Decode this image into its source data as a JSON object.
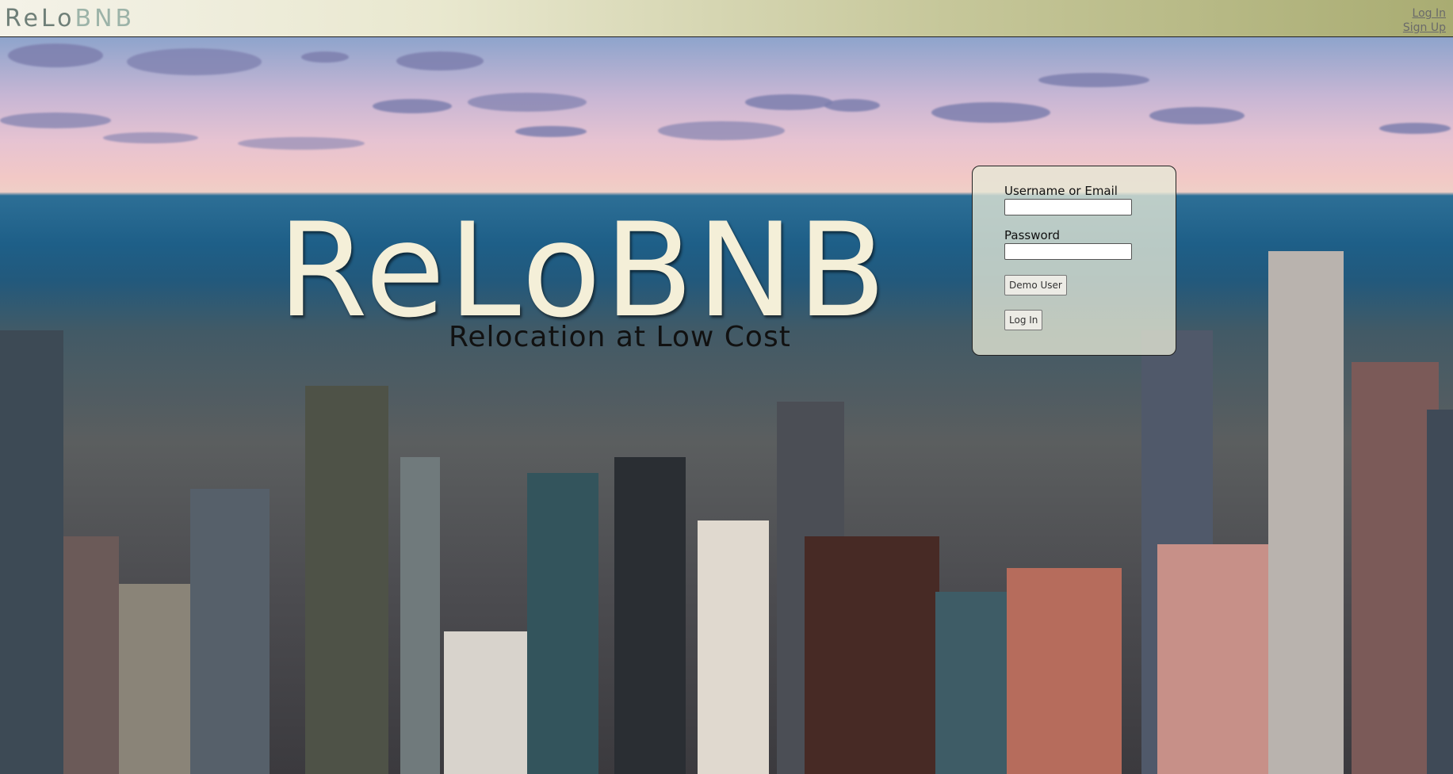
{
  "navbar": {
    "logo_part1": "ReLo",
    "logo_part2": "BNB",
    "login_link": "Log In",
    "signup_link": "Sign Up"
  },
  "hero": {
    "title": "ReLoBNB",
    "subtitle": "Relocation at Low Cost"
  },
  "login_form": {
    "username_label": "Username or Email",
    "username_value": "",
    "password_label": "Password",
    "password_value": "",
    "demo_button": "Demo User",
    "login_button": "Log In"
  },
  "colors": {
    "title_color": "#f4efd8",
    "navbar_start": "#f4f2e8",
    "navbar_end": "#a9ac72"
  }
}
